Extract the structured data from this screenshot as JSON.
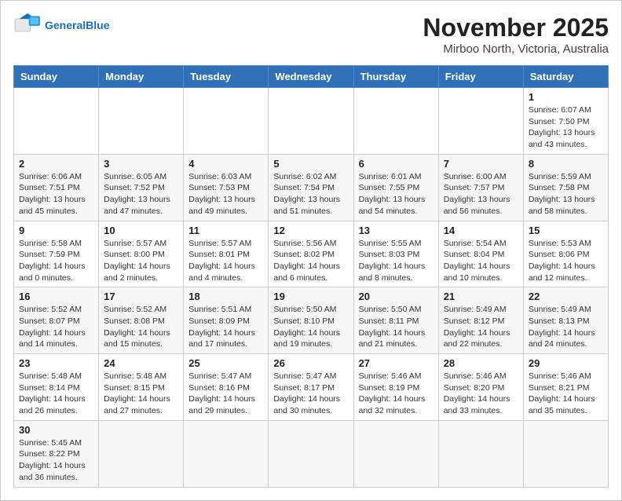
{
  "header": {
    "logo_general": "General",
    "logo_blue": "Blue",
    "month_title": "November 2025",
    "location": "Mirboo North, Victoria, Australia"
  },
  "weekdays": [
    "Sunday",
    "Monday",
    "Tuesday",
    "Wednesday",
    "Thursday",
    "Friday",
    "Saturday"
  ],
  "days": {
    "d1": {
      "num": "1",
      "sunrise": "Sunrise: 6:07 AM",
      "sunset": "Sunset: 7:50 PM",
      "daylight": "Daylight: 13 hours and 43 minutes."
    },
    "d2": {
      "num": "2",
      "sunrise": "Sunrise: 6:06 AM",
      "sunset": "Sunset: 7:51 PM",
      "daylight": "Daylight: 13 hours and 45 minutes."
    },
    "d3": {
      "num": "3",
      "sunrise": "Sunrise: 6:05 AM",
      "sunset": "Sunset: 7:52 PM",
      "daylight": "Daylight: 13 hours and 47 minutes."
    },
    "d4": {
      "num": "4",
      "sunrise": "Sunrise: 6:03 AM",
      "sunset": "Sunset: 7:53 PM",
      "daylight": "Daylight: 13 hours and 49 minutes."
    },
    "d5": {
      "num": "5",
      "sunrise": "Sunrise: 6:02 AM",
      "sunset": "Sunset: 7:54 PM",
      "daylight": "Daylight: 13 hours and 51 minutes."
    },
    "d6": {
      "num": "6",
      "sunrise": "Sunrise: 6:01 AM",
      "sunset": "Sunset: 7:55 PM",
      "daylight": "Daylight: 13 hours and 54 minutes."
    },
    "d7": {
      "num": "7",
      "sunrise": "Sunrise: 6:00 AM",
      "sunset": "Sunset: 7:57 PM",
      "daylight": "Daylight: 13 hours and 56 minutes."
    },
    "d8": {
      "num": "8",
      "sunrise": "Sunrise: 5:59 AM",
      "sunset": "Sunset: 7:58 PM",
      "daylight": "Daylight: 13 hours and 58 minutes."
    },
    "d9": {
      "num": "9",
      "sunrise": "Sunrise: 5:58 AM",
      "sunset": "Sunset: 7:59 PM",
      "daylight": "Daylight: 14 hours and 0 minutes."
    },
    "d10": {
      "num": "10",
      "sunrise": "Sunrise: 5:57 AM",
      "sunset": "Sunset: 8:00 PM",
      "daylight": "Daylight: 14 hours and 2 minutes."
    },
    "d11": {
      "num": "11",
      "sunrise": "Sunrise: 5:57 AM",
      "sunset": "Sunset: 8:01 PM",
      "daylight": "Daylight: 14 hours and 4 minutes."
    },
    "d12": {
      "num": "12",
      "sunrise": "Sunrise: 5:56 AM",
      "sunset": "Sunset: 8:02 PM",
      "daylight": "Daylight: 14 hours and 6 minutes."
    },
    "d13": {
      "num": "13",
      "sunrise": "Sunrise: 5:55 AM",
      "sunset": "Sunset: 8:03 PM",
      "daylight": "Daylight: 14 hours and 8 minutes."
    },
    "d14": {
      "num": "14",
      "sunrise": "Sunrise: 5:54 AM",
      "sunset": "Sunset: 8:04 PM",
      "daylight": "Daylight: 14 hours and 10 minutes."
    },
    "d15": {
      "num": "15",
      "sunrise": "Sunrise: 5:53 AM",
      "sunset": "Sunset: 8:06 PM",
      "daylight": "Daylight: 14 hours and 12 minutes."
    },
    "d16": {
      "num": "16",
      "sunrise": "Sunrise: 5:52 AM",
      "sunset": "Sunset: 8:07 PM",
      "daylight": "Daylight: 14 hours and 14 minutes."
    },
    "d17": {
      "num": "17",
      "sunrise": "Sunrise: 5:52 AM",
      "sunset": "Sunset: 8:08 PM",
      "daylight": "Daylight: 14 hours and 15 minutes."
    },
    "d18": {
      "num": "18",
      "sunrise": "Sunrise: 5:51 AM",
      "sunset": "Sunset: 8:09 PM",
      "daylight": "Daylight: 14 hours and 17 minutes."
    },
    "d19": {
      "num": "19",
      "sunrise": "Sunrise: 5:50 AM",
      "sunset": "Sunset: 8:10 PM",
      "daylight": "Daylight: 14 hours and 19 minutes."
    },
    "d20": {
      "num": "20",
      "sunrise": "Sunrise: 5:50 AM",
      "sunset": "Sunset: 8:11 PM",
      "daylight": "Daylight: 14 hours and 21 minutes."
    },
    "d21": {
      "num": "21",
      "sunrise": "Sunrise: 5:49 AM",
      "sunset": "Sunset: 8:12 PM",
      "daylight": "Daylight: 14 hours and 22 minutes."
    },
    "d22": {
      "num": "22",
      "sunrise": "Sunrise: 5:49 AM",
      "sunset": "Sunset: 8:13 PM",
      "daylight": "Daylight: 14 hours and 24 minutes."
    },
    "d23": {
      "num": "23",
      "sunrise": "Sunrise: 5:48 AM",
      "sunset": "Sunset: 8:14 PM",
      "daylight": "Daylight: 14 hours and 26 minutes."
    },
    "d24": {
      "num": "24",
      "sunrise": "Sunrise: 5:48 AM",
      "sunset": "Sunset: 8:15 PM",
      "daylight": "Daylight: 14 hours and 27 minutes."
    },
    "d25": {
      "num": "25",
      "sunrise": "Sunrise: 5:47 AM",
      "sunset": "Sunset: 8:16 PM",
      "daylight": "Daylight: 14 hours and 29 minutes."
    },
    "d26": {
      "num": "26",
      "sunrise": "Sunrise: 5:47 AM",
      "sunset": "Sunset: 8:17 PM",
      "daylight": "Daylight: 14 hours and 30 minutes."
    },
    "d27": {
      "num": "27",
      "sunrise": "Sunrise: 5:46 AM",
      "sunset": "Sunset: 8:19 PM",
      "daylight": "Daylight: 14 hours and 32 minutes."
    },
    "d28": {
      "num": "28",
      "sunrise": "Sunrise: 5:46 AM",
      "sunset": "Sunset: 8:20 PM",
      "daylight": "Daylight: 14 hours and 33 minutes."
    },
    "d29": {
      "num": "29",
      "sunrise": "Sunrise: 5:46 AM",
      "sunset": "Sunset: 8:21 PM",
      "daylight": "Daylight: 14 hours and 35 minutes."
    },
    "d30": {
      "num": "30",
      "sunrise": "Sunrise: 5:45 AM",
      "sunset": "Sunset: 8:22 PM",
      "daylight": "Daylight: 14 hours and 36 minutes."
    }
  }
}
